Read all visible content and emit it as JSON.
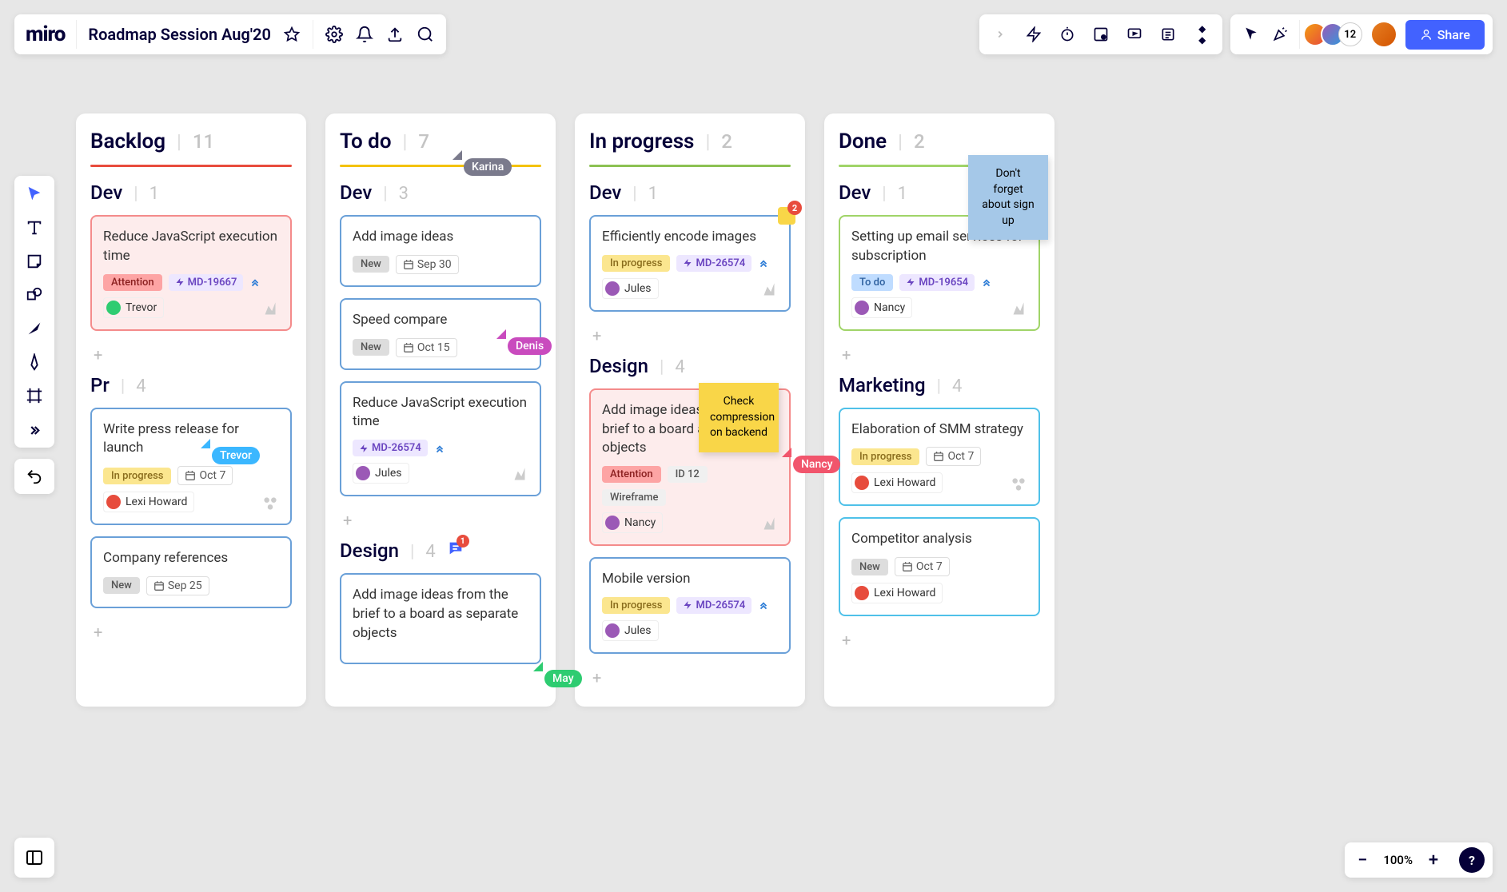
{
  "app": {
    "logo": "miro",
    "board_title": "Roadmap Session Aug'20",
    "share": "Share",
    "avatar_count": "12"
  },
  "zoom": {
    "level": "100%"
  },
  "cursors": {
    "karina": "Karina",
    "trevor": "Trevor",
    "denis": "Denis",
    "may": "May",
    "nancy": "Nancy"
  },
  "sticky": {
    "yellow": "Check compression on backend",
    "blue": "Don't forget about sign up"
  },
  "columns": [
    {
      "title": "Backlog",
      "count": "11",
      "rule": "red",
      "sections": [
        {
          "title": "Dev",
          "count": "1",
          "cards": [
            {
              "title": "Reduce JavaScript execution time",
              "style": "red",
              "tags": [
                {
                  "t": "Attention",
                  "c": "attention"
                }
              ],
              "id": "MD-19667",
              "prio": true,
              "assignee": "Trevor",
              "sync": true
            }
          ]
        },
        {
          "title": "Pr",
          "count": "4",
          "cards": [
            {
              "title": "Write press release for launch",
              "style": "blue",
              "tags": [
                {
                  "t": "In progress",
                  "c": "inprogress"
                }
              ],
              "date": "Oct 7",
              "assignee": "Lexi Howard",
              "dots": true
            },
            {
              "title": "Company references",
              "style": "blue",
              "tags": [
                {
                  "t": "New",
                  "c": "new"
                }
              ],
              "date": "Sep 25"
            }
          ]
        }
      ]
    },
    {
      "title": "To do",
      "count": "7",
      "rule": "yellow",
      "sections": [
        {
          "title": "Dev",
          "count": "3",
          "cards": [
            {
              "title": "Add image ideas",
              "style": "blue",
              "tags": [
                {
                  "t": "New",
                  "c": "new"
                }
              ],
              "date": "Sep 30"
            },
            {
              "title": "Speed compare",
              "style": "blue",
              "tags": [
                {
                  "t": "New",
                  "c": "new"
                }
              ],
              "date": "Oct 15"
            },
            {
              "title": "Reduce JavaScript execution time",
              "style": "blue",
              "id": "MD-26574",
              "prio": true,
              "assignee": "Jules",
              "sync": true
            }
          ]
        },
        {
          "title": "Design",
          "count": "4",
          "comment": "1",
          "cards": [
            {
              "title": "Add image ideas from the brief to a board as separate objects",
              "style": "blue",
              "partial": true
            }
          ]
        }
      ]
    },
    {
      "title": "In progress",
      "count": "2",
      "rule": "green",
      "sections": [
        {
          "title": "Dev",
          "count": "1",
          "cards": [
            {
              "title": "Efficiently encode images",
              "style": "blue",
              "tags": [
                {
                  "t": "In progress",
                  "c": "inprogress"
                }
              ],
              "id": "MD-26574",
              "prio": true,
              "assignee": "Jules",
              "sync": true,
              "comment": "2"
            }
          ]
        },
        {
          "title": "Design",
          "count": "4",
          "cards": [
            {
              "title": "Add image ideas from the brief to a board as separate objects",
              "style": "red",
              "tags": [
                {
                  "t": "Attention",
                  "c": "attention"
                },
                {
                  "t": "ID 12",
                  "c": "plain"
                },
                {
                  "t": "Wireframe",
                  "c": "plain"
                }
              ],
              "assignee": "Nancy",
              "sync": true
            },
            {
              "title": "Mobile version",
              "style": "blue",
              "tags": [
                {
                  "t": "In progress",
                  "c": "inprogress"
                }
              ],
              "id": "MD-26574",
              "prio": true,
              "assignee": "Jules"
            }
          ]
        }
      ]
    },
    {
      "title": "Done",
      "count": "2",
      "rule": "lime",
      "sections": [
        {
          "title": "Dev",
          "count": "1",
          "cards": [
            {
              "title": "Setting up email services for subscription",
              "style": "green",
              "tags": [
                {
                  "t": "To do",
                  "c": "todo"
                }
              ],
              "id": "MD-19654",
              "prio": true,
              "assignee": "Nancy",
              "sync": true
            }
          ]
        },
        {
          "title": "Marketing",
          "count": "4",
          "cards": [
            {
              "title": "Elaboration of SMM strategy",
              "style": "cyan",
              "tags": [
                {
                  "t": "In progress",
                  "c": "inprogress"
                }
              ],
              "date": "Oct 7",
              "assignee": "Lexi Howard",
              "dots": true
            },
            {
              "title": "Competitor analysis",
              "style": "cyan",
              "tags": [
                {
                  "t": "New",
                  "c": "new"
                }
              ],
              "date": "Oct 7",
              "assignee": "Lexi Howard"
            }
          ]
        }
      ]
    }
  ]
}
